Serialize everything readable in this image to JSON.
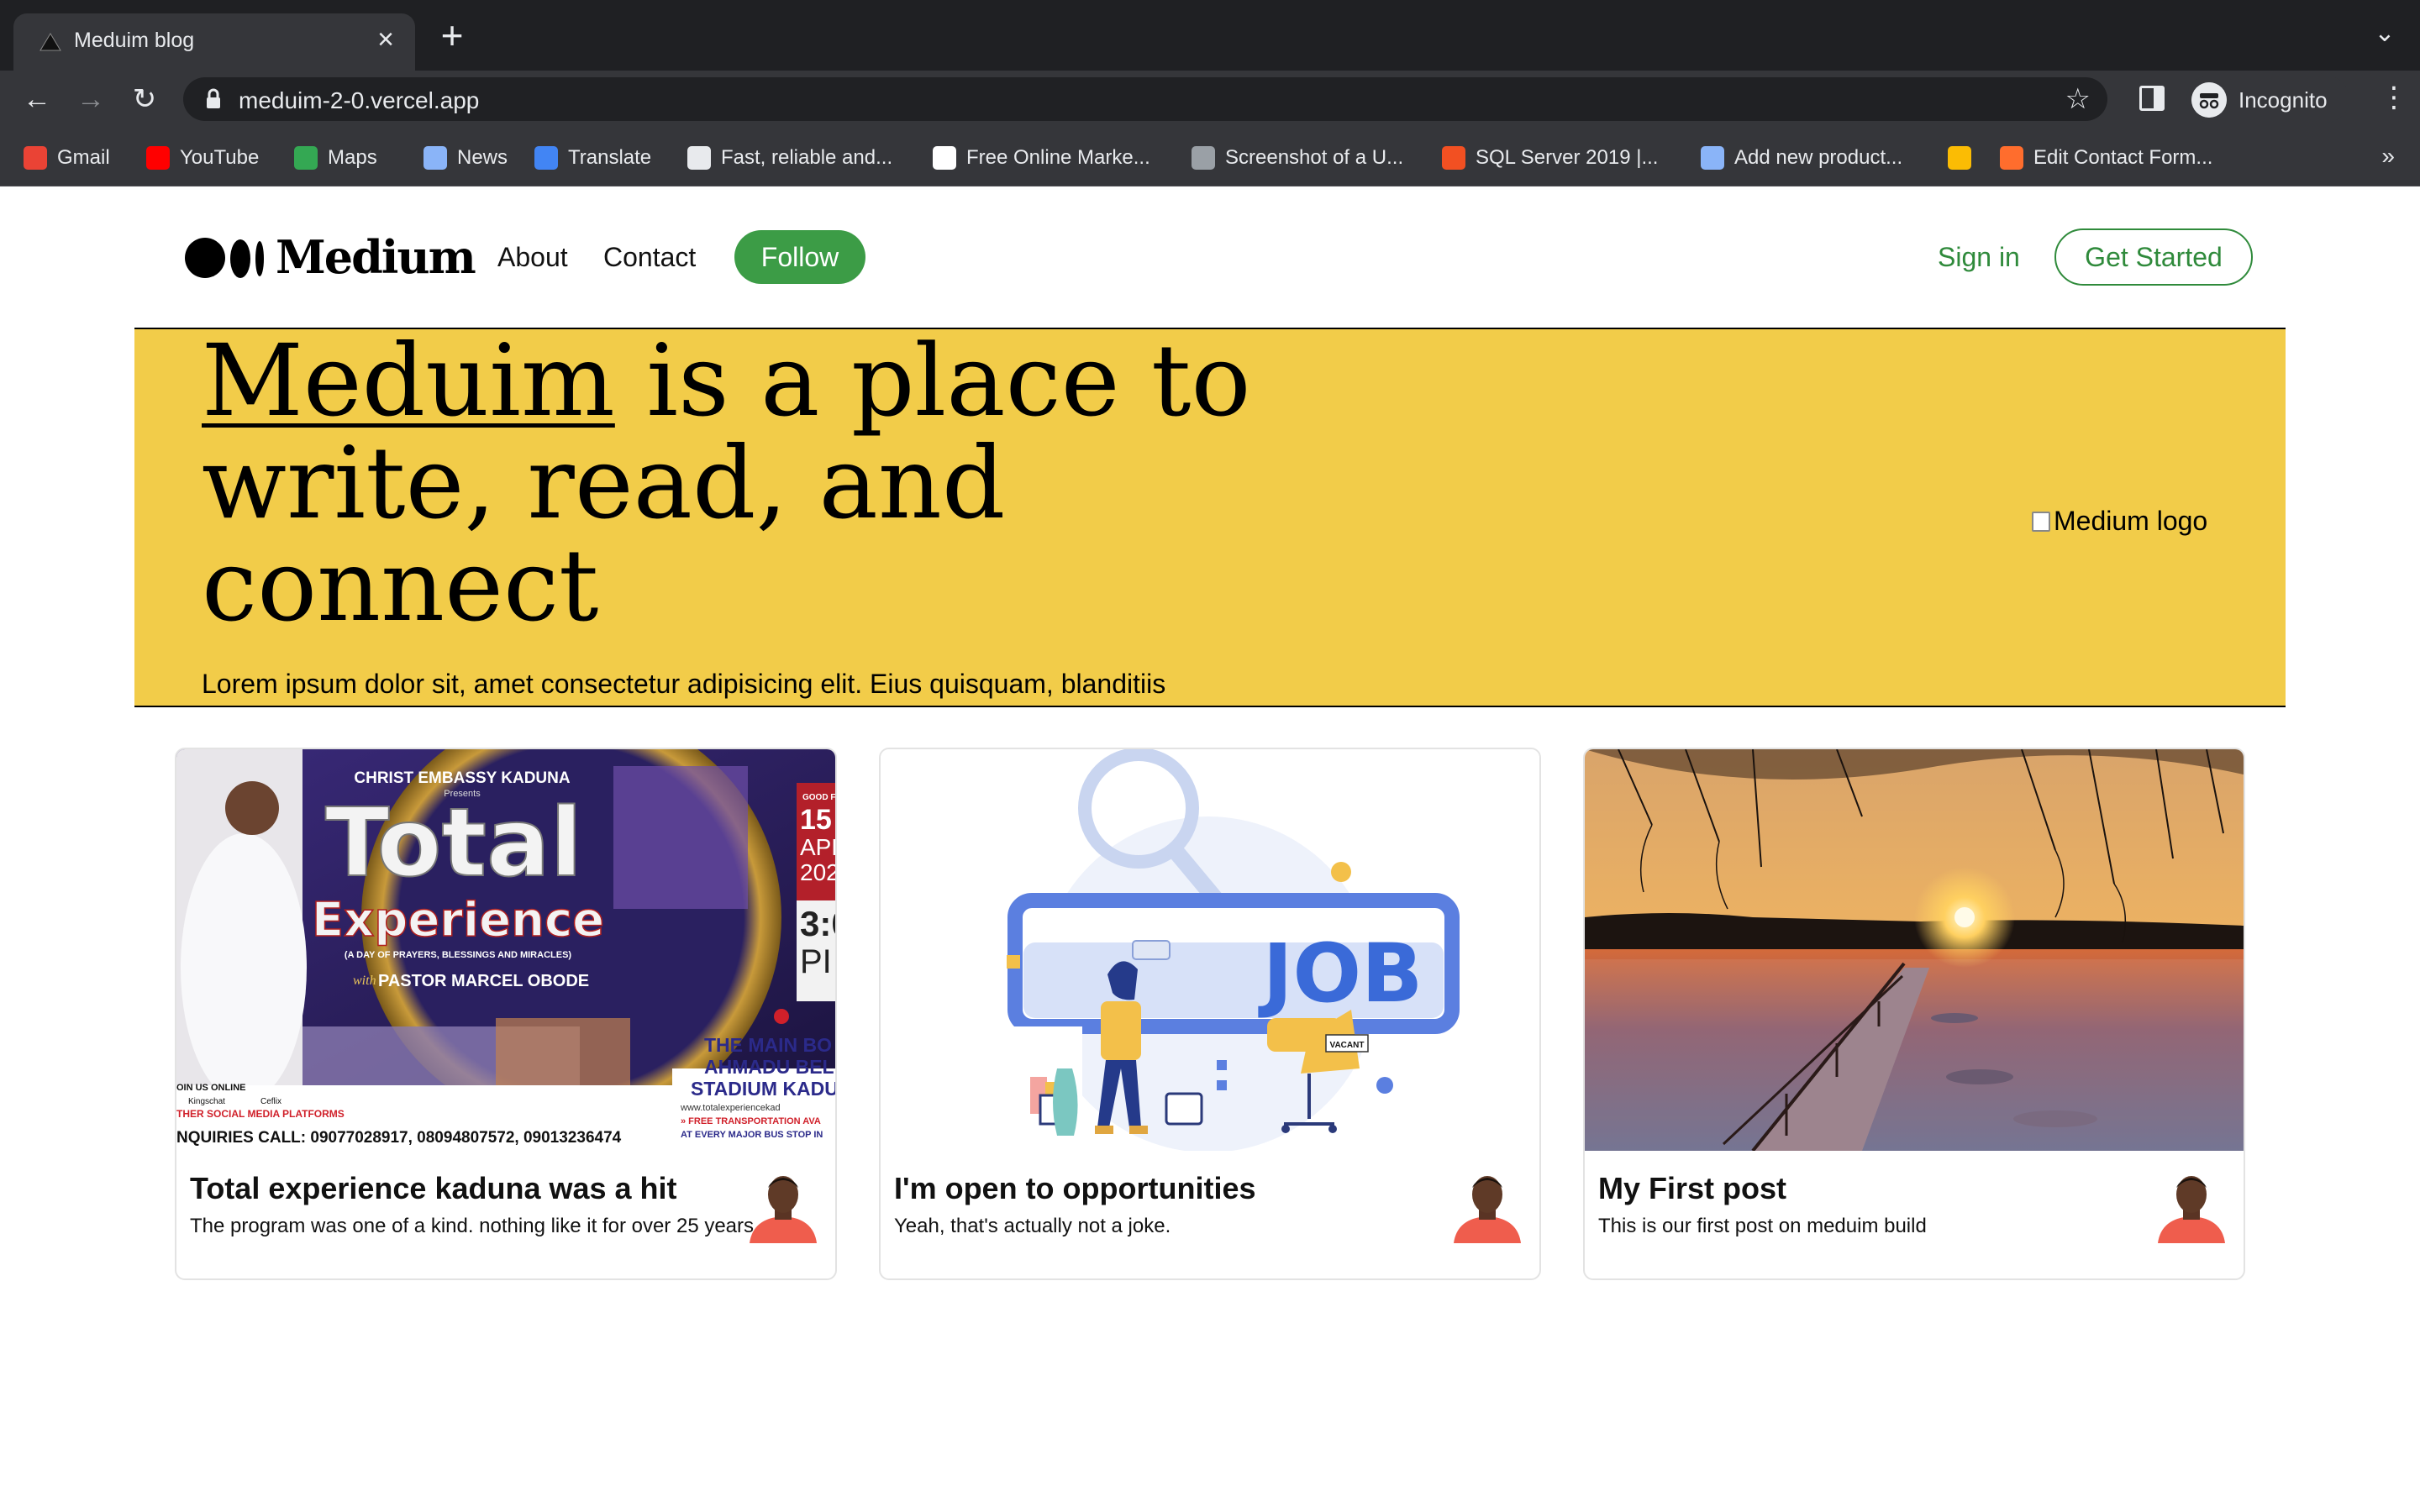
{
  "browser": {
    "tab_title": "Meduim blog",
    "url": "meduim-2-0.vercel.app",
    "profile_label": "Incognito",
    "bookmarks": [
      {
        "label": "Gmail",
        "icon": "gmail-icon",
        "color": "#ea4335"
      },
      {
        "label": "YouTube",
        "icon": "youtube-icon",
        "color": "#ff0000"
      },
      {
        "label": "Maps",
        "icon": "maps-icon",
        "color": "#34a853"
      },
      {
        "label": "News",
        "icon": "news-icon",
        "color": "#8ab4f8"
      },
      {
        "label": "Translate",
        "icon": "translate-icon",
        "color": "#4285f4"
      },
      {
        "label": "Fast, reliable and...",
        "icon": "q-icon",
        "color": "#e8eaed"
      },
      {
        "label": "Free Online Marke...",
        "icon": "google-icon",
        "color": "#ffffff"
      },
      {
        "label": "Screenshot of a U...",
        "icon": "globe-icon",
        "color": "#9aa0a6"
      },
      {
        "label": "SQL Server 2019 |...",
        "icon": "microsoft-icon",
        "color": "#f25022"
      },
      {
        "label": "Add new product...",
        "icon": "product-icon",
        "color": "#8ab4f8"
      },
      {
        "label": "",
        "icon": "drive-icon",
        "color": "#fbbc04"
      },
      {
        "label": "Edit Contact Form...",
        "icon": "form-icon",
        "color": "#ff6d2d"
      }
    ],
    "more_label": "»"
  },
  "site": {
    "brand": "Medium",
    "nav": {
      "about": "About",
      "contact": "Contact",
      "follow": "Follow"
    },
    "sign_in": "Sign in",
    "get_started": "Get Started",
    "accent_color": "#3c9c46",
    "hero": {
      "title_link": "Meduim",
      "title_rest": " is a place to write, read, and connect",
      "subtitle": "Lorem ipsum dolor sit, amet consectetur adipisicing elit. Eius quisquam, blanditiis",
      "image_alt": "Medium logo",
      "background": "#f2cc49"
    },
    "posts": [
      {
        "title": "Total experience kaduna was a hit",
        "description": "The program was one of a kind. nothing like it for over 25 years",
        "image": "event-flyer"
      },
      {
        "title": "I'm open to opportunities",
        "description": "Yeah, that's actually not a joke.",
        "image": "job-illustration"
      },
      {
        "title": "My First post",
        "description": "This is our first post on meduim build",
        "image": "sunset-pier-photo"
      }
    ]
  },
  "images": {
    "flyer": {
      "org": "CHRIST EMBASSY KADUNA",
      "presents": "Presents",
      "headline1": "Total",
      "headline2": "Experience",
      "tagline": "(A DAY OF PRAYERS, BLESSINGS AND MIRACLES)",
      "with": "with",
      "pastor": "PASTOR MARCEL OBODE",
      "date_top": "GOOD F",
      "date_day": "15",
      "date_month": "APR",
      "date_year": "202",
      "time": "3:0",
      "time_ampm": "PI",
      "venue1": "THE MAIN BO",
      "venue2": "AHMADU BEL",
      "venue3": "STADIUM KADU",
      "site": "www.totalexperiencekad",
      "transport": "» FREE TRANSPORTATION AVA",
      "bus": "AT EVERY MAJOR BUS STOP IN",
      "online": "OIN US ONLINE",
      "kingschat": "Kingschat",
      "ceflix": "Ceflix",
      "social": "THER SOCIAL MEDIA PLATFORMS",
      "inquiries": "NQUIRIES CALL: 09077028917, 08094807572, 09013236474"
    },
    "job": {
      "word": "JOB",
      "sign": "VACANT"
    }
  }
}
